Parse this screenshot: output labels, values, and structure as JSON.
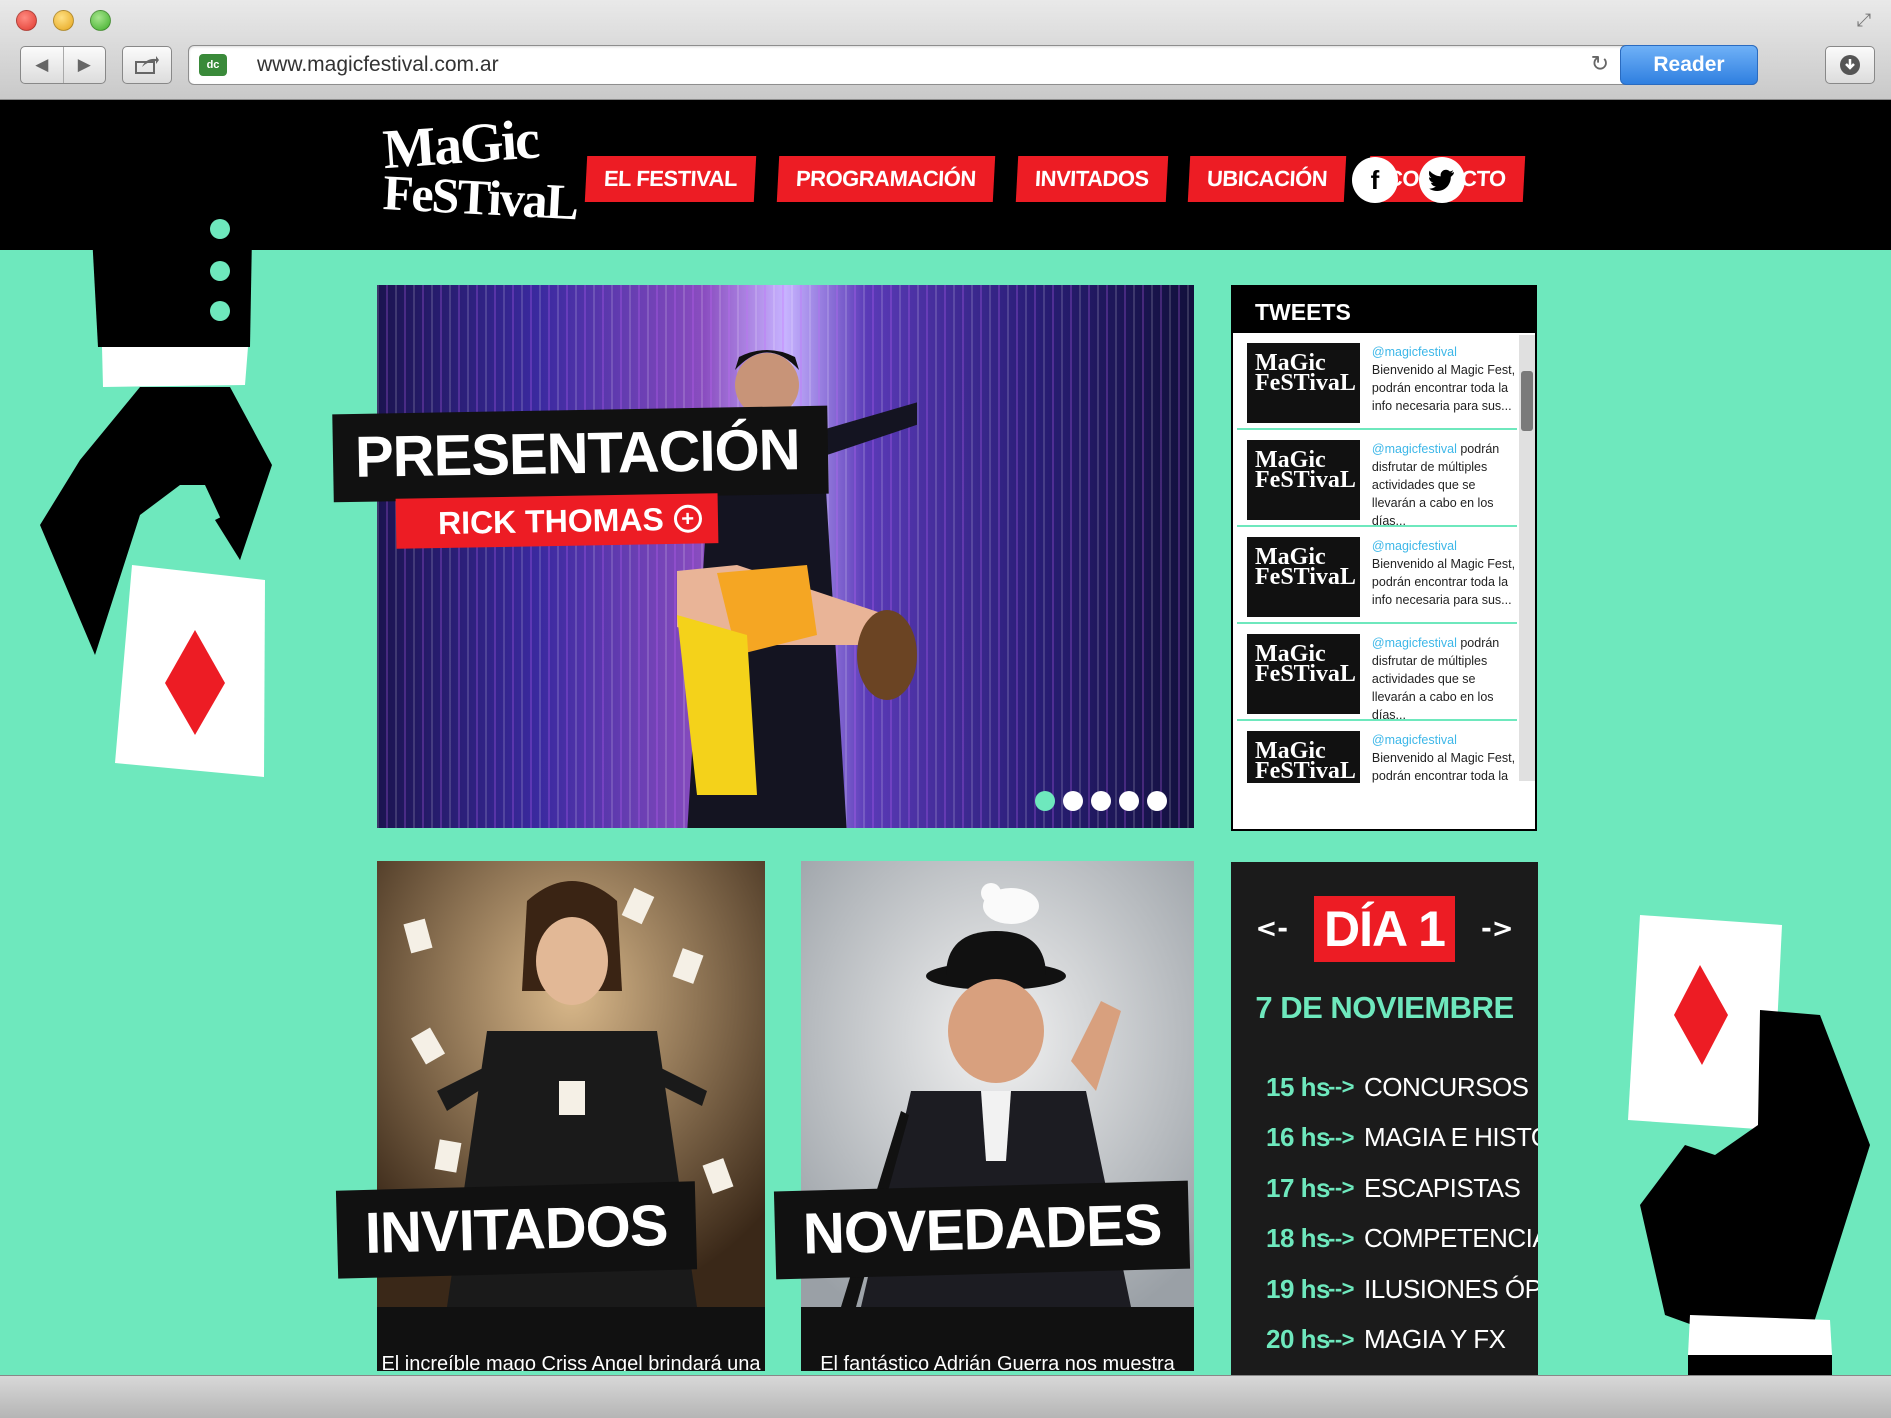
{
  "browser": {
    "url": "www.magicfestival.com.ar",
    "reader_label": "Reader",
    "back_glyph": "◀",
    "forward_glyph": "▶",
    "reload_glyph": "↻",
    "fullscreen_glyph": "⤢",
    "site_icon_text": "dc"
  },
  "header": {
    "logo_line1": "MaGic",
    "logo_line2": "FeSTivaL",
    "nav": [
      "EL FESTIVAL",
      "PROGRAMACIÓN",
      "INVITADOS",
      "UBICACIÓN",
      "CONTACTO"
    ],
    "social": {
      "facebook": "f",
      "twitter": "t"
    }
  },
  "hero": {
    "title": "PRESENTACIÓN",
    "subtitle": "RICK THOMAS",
    "plus": "+",
    "slide_count": 5,
    "active_slide": 1
  },
  "tweets": {
    "heading": "TWEETS",
    "avatar_line1": "MaGic",
    "avatar_line2": "FeSTivaL",
    "items": [
      {
        "handle": "@magicfestival",
        "text": " Bienvenido al Magic Fest, podrán encontrar toda la info necesaria para sus..."
      },
      {
        "handle": "@magicfestival",
        "text": " podrán disfrutar de múltiples actividades que se llevarán a cabo en los días..."
      },
      {
        "handle": "@magicfestival",
        "text": " Bienvenido al Magic Fest, podrán encontrar toda la info necesaria para sus..."
      },
      {
        "handle": "@magicfestival",
        "text": " podrán disfrutar de múltiples actividades que se llevarán a cabo en los días..."
      },
      {
        "handle": "@magicfestival",
        "text": " Bienvenido al Magic Fest, podrán encontrar toda la info"
      }
    ]
  },
  "cards": {
    "invitados": {
      "label": "INVITADOS",
      "text": "El increíble mago Criss Angel brindará una"
    },
    "novedades": {
      "label": "NOVEDADES",
      "text": "El fantástico Adrián Guerra nos muestra"
    }
  },
  "schedule": {
    "prev": "<-",
    "next": "->",
    "day": "DÍA 1",
    "date": "7 DE NOVIEMBRE",
    "arrow": "-->",
    "events": [
      {
        "time": "15 hs",
        "event": "CONCURSOS"
      },
      {
        "time": "16 hs",
        "event": "MAGIA E HISTORIA"
      },
      {
        "time": "17 hs",
        "event": "ESCAPISTAS"
      },
      {
        "time": "18 hs",
        "event": "COMPETENCIAS"
      },
      {
        "time": "19 hs",
        "event": "ILUSIONES ÓPTICAS"
      },
      {
        "time": "20 hs",
        "event": "MAGIA Y FX"
      }
    ]
  },
  "colors": {
    "background": "#6ee8bd",
    "accent_red": "#ed1c24",
    "black": "#000000",
    "twitter_handle": "#3db7e8"
  }
}
